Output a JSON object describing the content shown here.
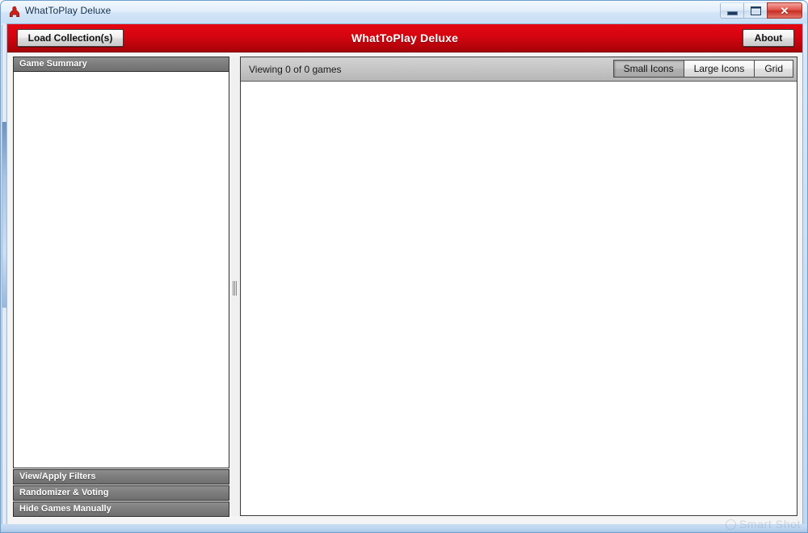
{
  "window": {
    "title": "WhatToPlay Deluxe",
    "icon": "meeple-icon",
    "controls": {
      "minimize": "minimize-icon",
      "maximize": "maximize-icon",
      "close": "✕"
    }
  },
  "header": {
    "title": "WhatToPlay Deluxe",
    "load_label": "Load Collection(s)",
    "about_label": "About",
    "accent_color": "#d40510"
  },
  "sidebar": {
    "sections": [
      {
        "label": "Game Summary",
        "expanded": true
      },
      {
        "label": "View/Apply Filters",
        "expanded": false
      },
      {
        "label": "Randomizer & Voting",
        "expanded": false
      },
      {
        "label": "Hide Games Manually",
        "expanded": false
      }
    ]
  },
  "content": {
    "viewing_status": "Viewing 0 of 0 games",
    "view_modes": [
      {
        "label": "Small Icons",
        "active": true
      },
      {
        "label": "Large Icons",
        "active": false
      },
      {
        "label": "Grid",
        "active": false
      }
    ],
    "games": []
  },
  "watermark": {
    "text": "Smart Shot"
  }
}
